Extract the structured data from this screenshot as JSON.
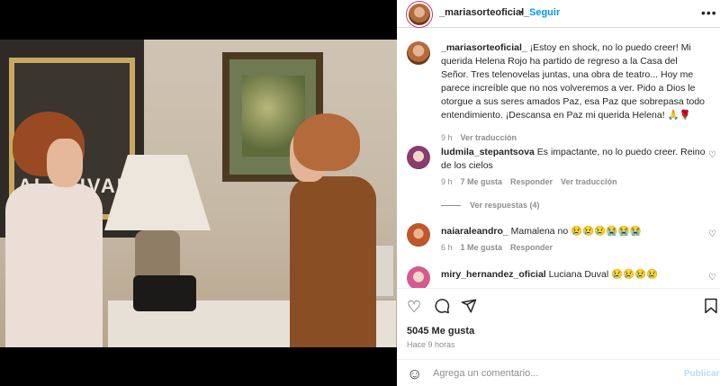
{
  "post": {
    "username": "_mariasorteoficial_",
    "separator": "•",
    "follow_label": "Seguir",
    "more_label": "•••"
  },
  "caption": {
    "username": "_mariasorteoficial_",
    "text": " ¡Estoy en shock, no lo puedo creer! Mi querida Helena Rojo ha partido de regreso a la Casa del Señor. Tres telenovelas juntas, una obra de teatro... Hoy me parece increíble que no nos volveremos a ver. Pido a Dios le otorgue a sus seres amados Paz, esa Paz que sobrepasa todo entendimiento. ¡Descansa en Paz mi querida Helena! 🙏🌹",
    "time": "9 h",
    "translate": "Ver traducción"
  },
  "comments": [
    {
      "username": "ludmila_stepantsova",
      "text": " Es impactante, no lo puedo creer. Reino de los cielos",
      "time": "9 h",
      "likes": "7 Me gusta",
      "reply": "Responder",
      "translate": "Ver traducción",
      "view_replies": "Ver respuestas (4)"
    },
    {
      "username": "naiaraleandro_",
      "text": " Mamalena no 😢😢😢😭😭😭",
      "time": "6 h",
      "likes": "1 Me gusta",
      "reply": "Responder"
    },
    {
      "username": "miry_hernandez_oficial",
      "text": " Luciana Duval 😢😢😢😢"
    }
  ],
  "icons": {
    "like": "heart-icon",
    "comment": "comment-icon",
    "share": "share-icon",
    "save": "bookmark-icon",
    "emoji": "smiley-icon"
  },
  "stats": {
    "likes": "5045 Me gusta",
    "time": "Hace 9 horas"
  },
  "add_comment": {
    "placeholder": "Agrega un comentario...",
    "post_label": "Publicar"
  },
  "video": {
    "sign_text": "AL DUVAL"
  },
  "colors": {
    "accent": "#0095f6",
    "muted": "#8e8e8e",
    "text": "#262626",
    "post_disabled": "#b2dffc"
  }
}
